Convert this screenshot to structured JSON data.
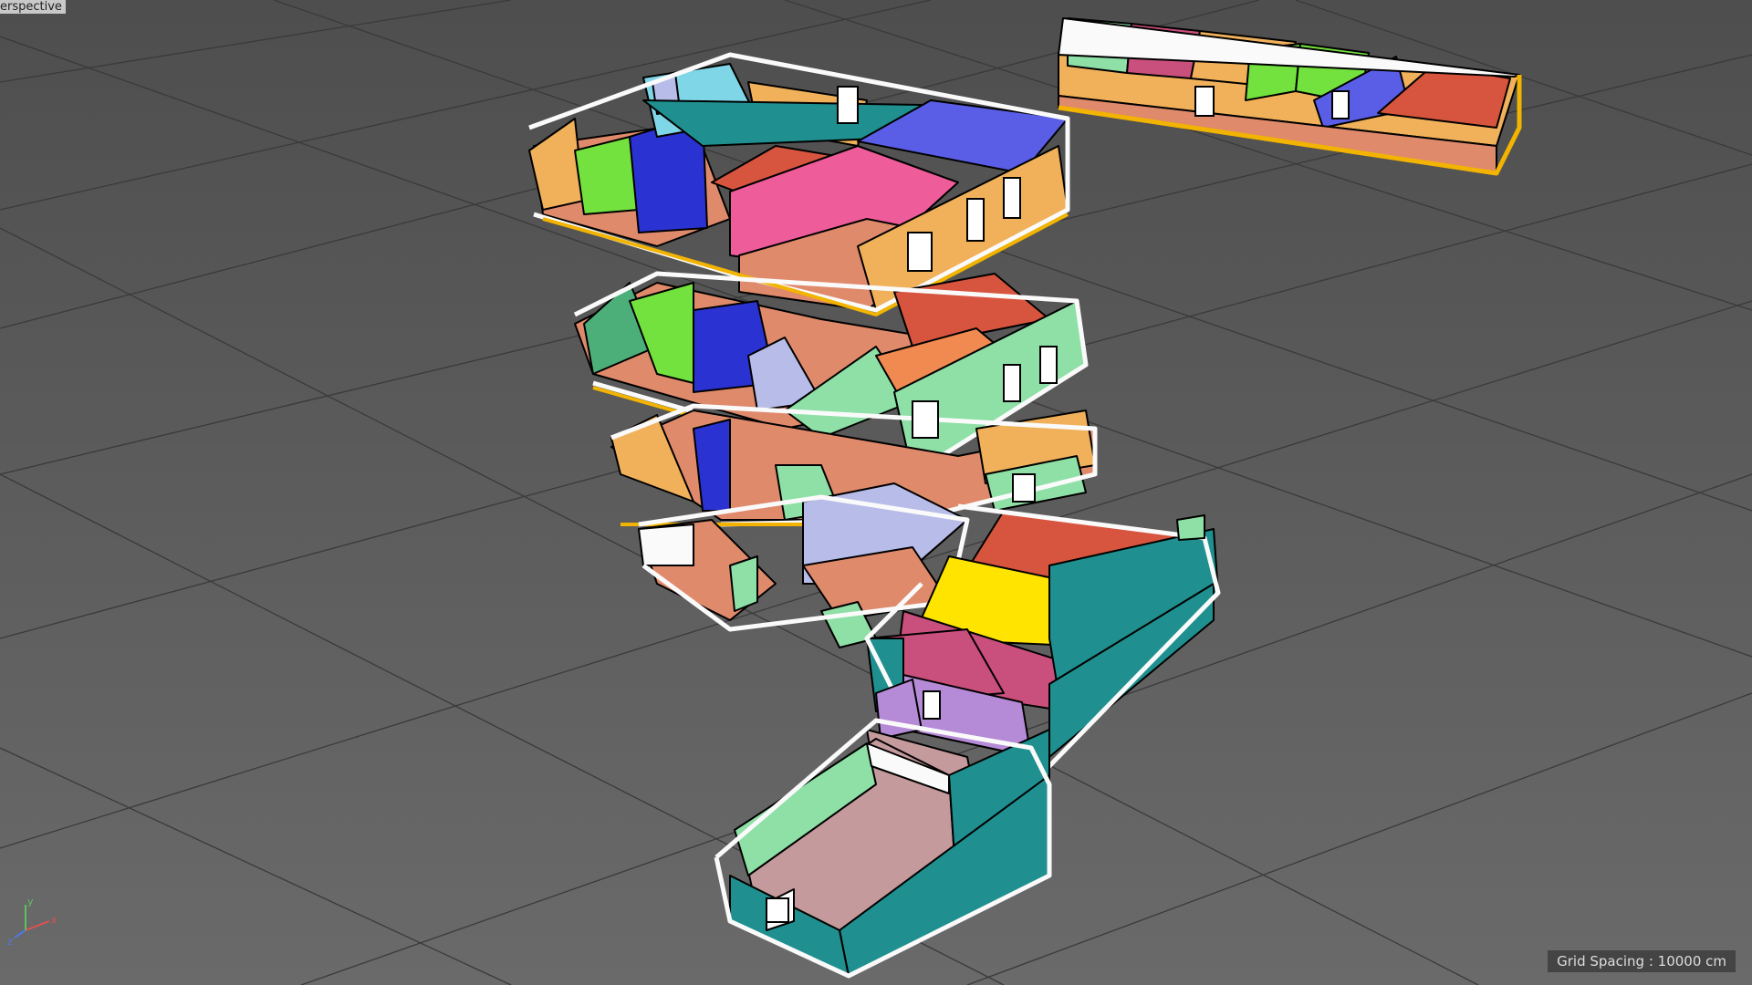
{
  "viewport": {
    "view_label": "erspective",
    "grid_spacing_label": "Grid Spacing : 10000 cm",
    "axis_labels": {
      "x": "x",
      "y": "y",
      "z": "z"
    }
  },
  "colors": {
    "background_top": "#4e4e4e",
    "background_bottom": "#6a6a6a",
    "grid_line": "#3a3a3a",
    "edge": "#000000",
    "wall_cap": "#ffffff",
    "slab_edge": "#f2b400",
    "floor_salmon": "#e08a6c",
    "wall_orange": "#f0b15a",
    "wall_red": "#d7553e",
    "wall_pink": "#ee5c9a",
    "wall_magenta": "#c94f7c",
    "wall_blue": "#5a5ee6",
    "wall_deep_blue": "#2b32d2",
    "wall_lavender": "#b8bce8",
    "wall_cyan": "#7fd6e6",
    "wall_mint": "#8ee0a6",
    "wall_green": "#74e23e",
    "wall_teal": "#1f8f8f",
    "wall_yellow": "#ffe400",
    "wall_purple": "#b58ad6",
    "floor_mauve": "#c59a9c"
  },
  "icons": [
    "axis-gizmo-icon"
  ]
}
